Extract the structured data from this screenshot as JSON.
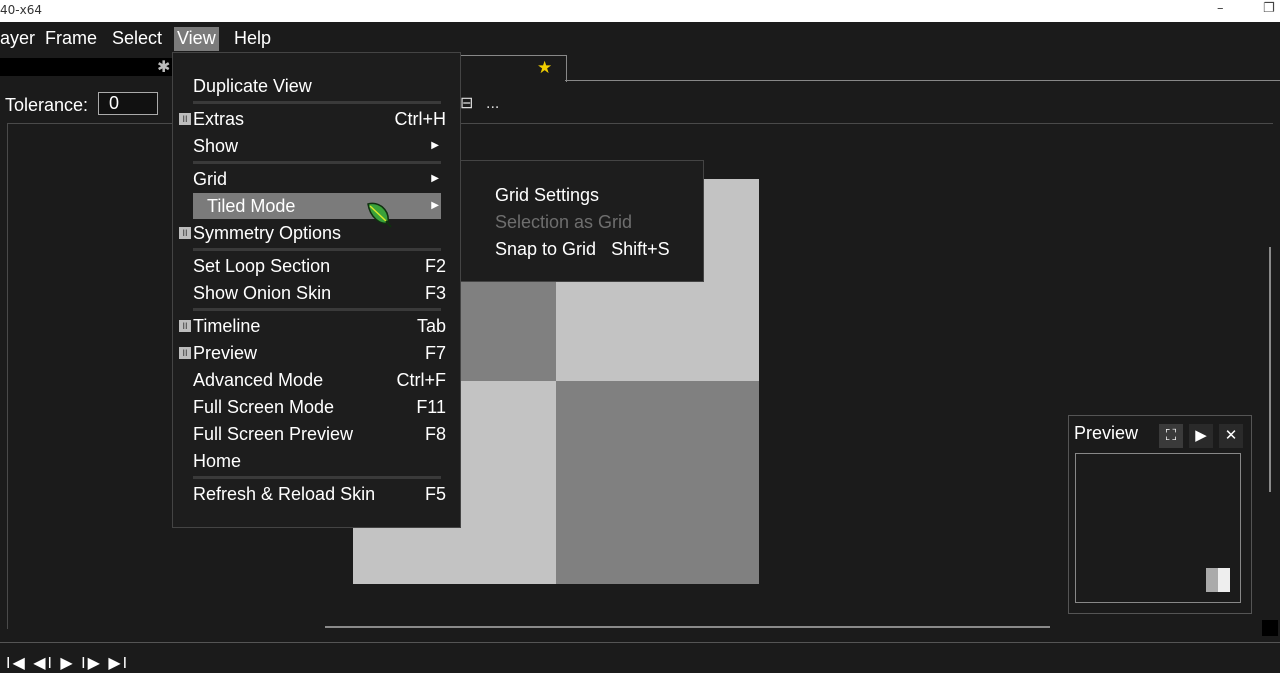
{
  "titlebar": {
    "title": "40-x64",
    "minimize": "–",
    "restore": "❐"
  },
  "menubar": {
    "items": [
      {
        "label": "ayer"
      },
      {
        "label": "Frame"
      },
      {
        "label": "Select"
      },
      {
        "label": "View"
      },
      {
        "label": "Help"
      }
    ]
  },
  "toolbar": {
    "tolerance_label": "Tolerance:",
    "tolerance_value": "0",
    "more": "..."
  },
  "tab": {
    "star_icon": "star-icon"
  },
  "preview": {
    "title": "Preview",
    "expand_icon": "⛶",
    "play_icon": "▶",
    "close_icon": "✕"
  },
  "playback": {
    "glyphs": "I◀ ◀I ▶ I▶ ▶I"
  },
  "view_menu": {
    "duplicate_view": "Duplicate View",
    "extras": "Extras",
    "extras_sc": "Ctrl+H",
    "show": "Show",
    "grid": "Grid",
    "tiled_mode": "Tiled Mode",
    "symmetry_options": "Symmetry Options",
    "set_loop_section": "Set Loop Section",
    "set_loop_sc": "F2",
    "show_onion_skin": "Show Onion Skin",
    "onion_sc": "F3",
    "timeline": "Timeline",
    "timeline_sc": "Tab",
    "preview": "Preview",
    "preview_sc": "F7",
    "advanced_mode": "Advanced Mode",
    "advanced_sc": "Ctrl+F",
    "full_screen_mode": "Full Screen Mode",
    "fsm_sc": "F11",
    "full_screen_preview": "Full Screen Preview",
    "fsp_sc": "F8",
    "home": "Home",
    "refresh_reload_skin": "Refresh & Reload Skin",
    "refresh_sc": "F5"
  },
  "grid_submenu": {
    "grid_settings": "Grid Settings",
    "selection_as_grid": "Selection as Grid",
    "snap_to_grid": "Snap to Grid",
    "snap_sc": "Shift+S"
  },
  "colors": {
    "highlight": "#7b7b7b",
    "light_tile": "#c3c3c3",
    "dark_tile": "#808080",
    "background": "#1b1b1b"
  }
}
